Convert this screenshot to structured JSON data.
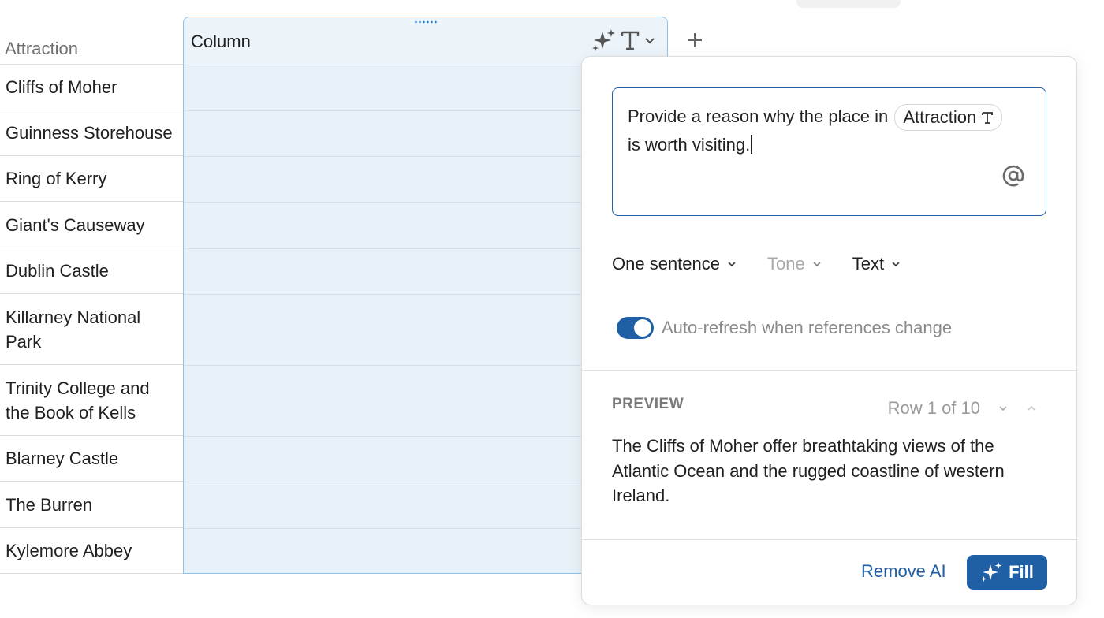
{
  "table": {
    "header_attraction": "Attraction",
    "new_column_title": "Column",
    "rows": [
      "Cliffs of Moher",
      "Guinness Storehouse",
      "Ring of Kerry",
      "Giant's Causeway",
      "Dublin Castle",
      "Killarney National Park",
      "Trinity College and the Book of Kells",
      "Blarney Castle",
      "The Burren",
      "Kylemore Abbey"
    ]
  },
  "popover": {
    "prompt_before": "Provide a reason why the place in",
    "prompt_chip": "Attraction",
    "prompt_after": "is worth visiting.",
    "options": {
      "length": "One sentence",
      "tone": "Tone",
      "format": "Text"
    },
    "auto_refresh_label": "Auto-refresh when references change",
    "auto_refresh_on": true,
    "preview_label": "PREVIEW",
    "row_indicator": "Row 1 of 10",
    "preview_text": "The Cliffs of Moher offer breathtaking views of the Atlantic Ocean and the rugged coastline of western Ireland.",
    "remove_ai_label": "Remove AI",
    "fill_label": "Fill"
  },
  "colors": {
    "accent": "#1f5fa6",
    "column_highlight": "#e9f1f8",
    "column_border": "#8cc1ea"
  },
  "icons": [
    "sparkles-icon",
    "text-type-icon",
    "chevron-down-icon",
    "plus-icon",
    "at-mention-icon",
    "chevron-up-icon"
  ]
}
